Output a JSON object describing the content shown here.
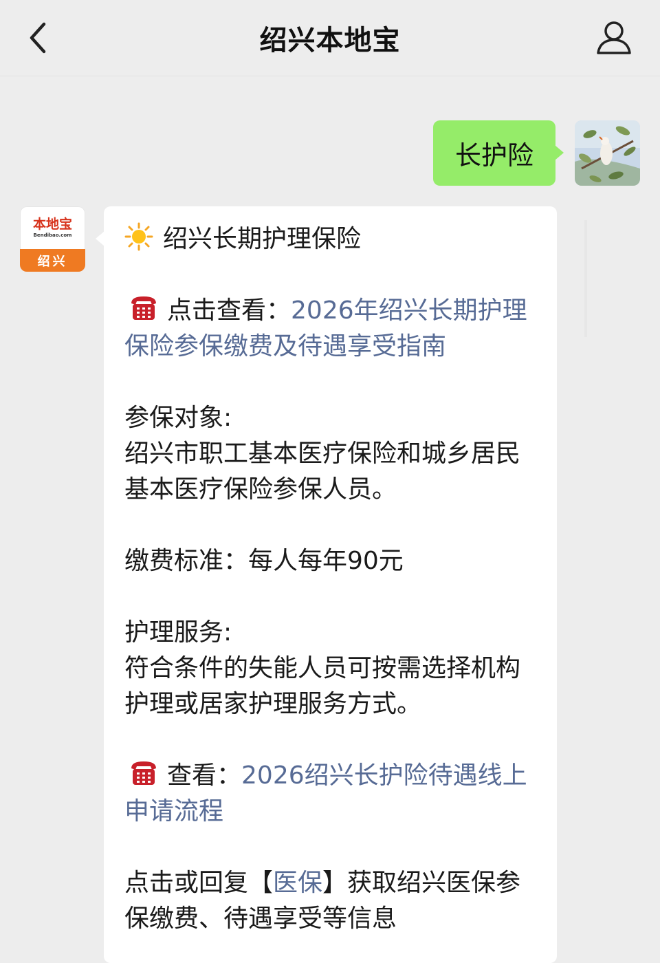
{
  "header": {
    "title": "绍兴本地宝",
    "back_icon": "chevron-left-icon",
    "profile_icon": "person-icon"
  },
  "outgoing": {
    "text": "长护险"
  },
  "bot_avatar": {
    "logo_text": "本地宝",
    "logo_sub": "Bendibao.com",
    "city_text": "绍兴"
  },
  "message": {
    "title_icon": "sun-icon",
    "title": "绍兴长期护理保险",
    "link1_prefix": "点击查看：",
    "link1_text": "2026年绍兴长期护理保险参保缴费及待遇享受指南",
    "subject_label": "参保对象:",
    "subject_text": "绍兴市职工基本医疗保险和城乡居民基本医疗保险参保人员。",
    "fee_text": "缴费标准：每人每年90元",
    "service_label": "护理服务:",
    "service_text": "符合条件的失能人员可按需选择机构护理或居家护理服务方式。",
    "link2_prefix": "查看：",
    "link2_text": "2026绍兴长护险待遇线上申请流程",
    "footer_prefix": "点击或回复【",
    "footer_link": "医保",
    "footer_suffix": "】获取绍兴医保参保缴费、待遇享受等信息"
  },
  "colors": {
    "bubble_out": "#95ec69",
    "link": "#576b95",
    "background": "#ededed"
  }
}
